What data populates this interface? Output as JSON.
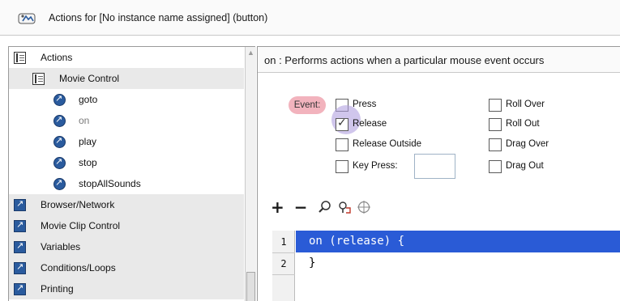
{
  "window": {
    "title": "Actions for [No instance name assigned] (button)"
  },
  "sidebar": {
    "items": [
      {
        "label": "Actions",
        "icon": "book-icon",
        "level": 0
      },
      {
        "label": "Movie Control",
        "icon": "book-icon",
        "level": 1
      },
      {
        "label": "goto",
        "icon": "action-icon",
        "level": 2
      },
      {
        "label": "on",
        "icon": "action-icon",
        "level": 2
      },
      {
        "label": "play",
        "icon": "action-icon",
        "level": 2
      },
      {
        "label": "stop",
        "icon": "action-icon",
        "level": 2
      },
      {
        "label": "stopAllSounds",
        "icon": "action-icon",
        "level": 2
      },
      {
        "label": "Browser/Network",
        "icon": "category-icon",
        "level": 1
      },
      {
        "label": "Movie Clip Control",
        "icon": "category-icon",
        "level": 1
      },
      {
        "label": "Variables",
        "icon": "category-icon",
        "level": 1
      },
      {
        "label": "Conditions/Loops",
        "icon": "category-icon",
        "level": 1
      },
      {
        "label": "Printing",
        "icon": "category-icon",
        "level": 1
      }
    ]
  },
  "main": {
    "description": "on : Performs actions when a particular mouse event occurs",
    "event_label": "Event:",
    "events": {
      "press": {
        "label": "Press",
        "checked": false
      },
      "release": {
        "label": "Release",
        "checked": true
      },
      "release_outside": {
        "label": "Release Outside",
        "checked": false
      },
      "key_press": {
        "label": "Key Press:",
        "checked": false,
        "value": ""
      },
      "roll_over": {
        "label": "Roll Over",
        "checked": false
      },
      "roll_out": {
        "label": "Roll Out",
        "checked": false
      },
      "drag_over": {
        "label": "Drag Over",
        "checked": false
      },
      "drag_out": {
        "label": "Drag Out",
        "checked": false
      }
    },
    "toolbar": {
      "add": "+",
      "remove": "−"
    },
    "code": {
      "lines": [
        {
          "num": "1",
          "text": "on (release) {"
        },
        {
          "num": "2",
          "text": "}"
        }
      ]
    }
  }
}
